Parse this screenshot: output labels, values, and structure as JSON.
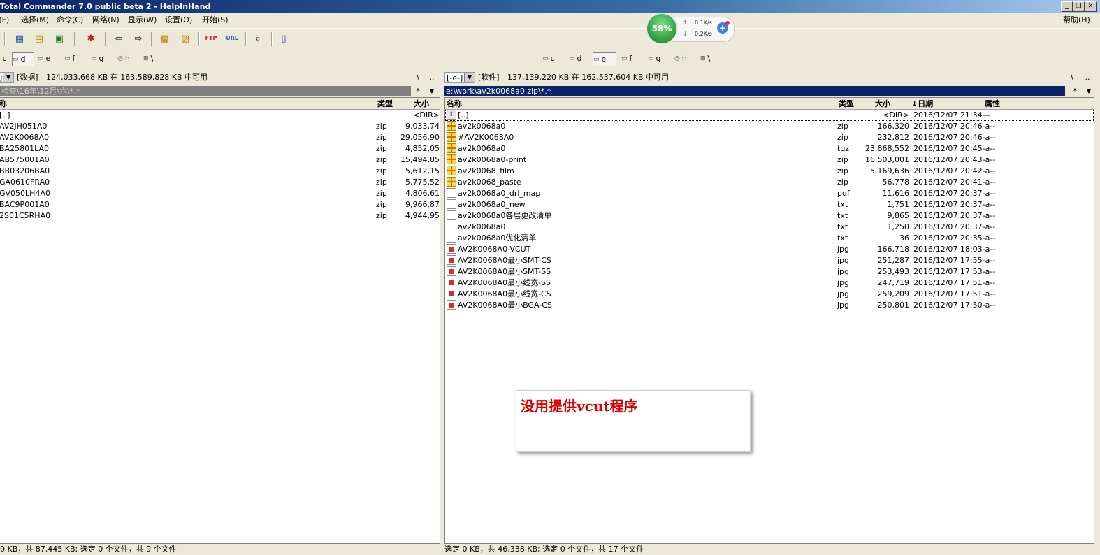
{
  "window": {
    "title": "Total Commander 7.0 public beta 2 - HelpInHand",
    "buttons": [
      "_",
      "❐",
      "✕"
    ]
  },
  "menu": {
    "items": [
      "F(F)",
      "选择(M)",
      "命令(C)",
      "网络(N)",
      "显示(W)",
      "设置(O)",
      "开始(S)"
    ],
    "help": "帮助(H)"
  },
  "netmon": {
    "percent": "58%",
    "upload": "0.1K/s",
    "download": "0.2K/s",
    "boost_icon": "+"
  },
  "left": {
    "drives": [
      {
        "letter": "c",
        "active": false
      },
      {
        "letter": "d",
        "active": true
      },
      {
        "letter": "e",
        "active": false
      },
      {
        "letter": "f",
        "active": false
      },
      {
        "letter": "g",
        "active": false
      },
      {
        "letter": "h",
        "active": false
      },
      {
        "letter": "\\",
        "active": false
      }
    ],
    "drive_combo": "]",
    "volume": "[数据]",
    "freespace": "124,033,668 KB 在 163,589,828 KB 中可用",
    "root_btn": "\\",
    "up_btn": "..",
    "path": "检查\\16年\\12月\\六\\*.*",
    "star_btn": "*",
    "columns": {
      "name": "称",
      "type": "类型",
      "size": "大小"
    },
    "files": [
      {
        "name": "[..]",
        "type": "",
        "size": "<DIR>"
      },
      {
        "name": "AV2JH051A0",
        "type": "zip",
        "size": "9,033,74"
      },
      {
        "name": "AV2K0068A0",
        "type": "zip",
        "size": "29,056,90"
      },
      {
        "name": "BA25801LA0",
        "type": "zip",
        "size": "4,852,05"
      },
      {
        "name": "AB575001A0",
        "type": "zip",
        "size": "15,494,85"
      },
      {
        "name": "BB03206BA0",
        "type": "zip",
        "size": "5,612,15"
      },
      {
        "name": "GA0610FRA0",
        "type": "zip",
        "size": "5,775,52"
      },
      {
        "name": "GV050LH4A0",
        "type": "zip",
        "size": "4,806,61"
      },
      {
        "name": "BAC9P001A0",
        "type": "zip",
        "size": "9,966,87"
      },
      {
        "name": "2S01C5RHA0",
        "type": "zip",
        "size": "4,944,95"
      }
    ],
    "status": "0 KB，共 87,445 KB; 选定 0 个文件，共 9 个文件"
  },
  "right": {
    "drives": [
      {
        "letter": "c",
        "active": false
      },
      {
        "letter": "d",
        "active": false
      },
      {
        "letter": "e",
        "active": true
      },
      {
        "letter": "f",
        "active": false
      },
      {
        "letter": "g",
        "active": false
      },
      {
        "letter": "h",
        "active": false
      },
      {
        "letter": "\\",
        "active": false
      }
    ],
    "drive_combo": "[-e-]",
    "volume": "[软件]",
    "freespace": "137,139,220 KB 在 162,537,604 KB 中可用",
    "root_btn": "\\",
    "up_btn": "..",
    "path": "e:\\work\\av2k0068a0.zip\\*.*",
    "star_btn": "*",
    "columns": {
      "name": "名称",
      "type": "类型",
      "size": "大小",
      "date": "↓日期",
      "attr": "属性"
    },
    "files": [
      {
        "icon": "up",
        "name": "[..]",
        "type": "",
        "size": "<DIR>",
        "date": "2016/12/07 21:34—"
      },
      {
        "icon": "zip",
        "name": "av2k0068a0",
        "type": "zip",
        "size": "166,320",
        "date": "2016/12/07 20:46-a--"
      },
      {
        "icon": "zip",
        "name": "#AV2K0068A0",
        "type": "zip",
        "size": "232,812",
        "date": "2016/12/07 20:46-a--"
      },
      {
        "icon": "zip",
        "name": "av2k0068a0",
        "type": "tgz",
        "size": "23,868,552",
        "date": "2016/12/07 20:45-a--"
      },
      {
        "icon": "zip",
        "name": "av2k0068a0-print",
        "type": "zip",
        "size": "16,503,001",
        "date": "2016/12/07 20:43-a--"
      },
      {
        "icon": "zip",
        "name": "av2k0068_film",
        "type": "zip",
        "size": "5,169,636",
        "date": "2016/12/07 20:42-a--"
      },
      {
        "icon": "zip",
        "name": "av2k0068_paste",
        "type": "zip",
        "size": "56,778",
        "date": "2016/12/07 20:41-a--"
      },
      {
        "icon": "doc",
        "name": "av2k0068a0_drl_map",
        "type": "pdf",
        "size": "11,616",
        "date": "2016/12/07 20:37-a--"
      },
      {
        "icon": "doc",
        "name": "av2k0068a0_new",
        "type": "txt",
        "size": "1,751",
        "date": "2016/12/07 20:37-a--"
      },
      {
        "icon": "doc",
        "name": "av2k0068a0各层更改清单",
        "type": "txt",
        "size": "9,865",
        "date": "2016/12/07 20:37-a--"
      },
      {
        "icon": "doc",
        "name": "av2k0068a0",
        "type": "txt",
        "size": "1,250",
        "date": "2016/12/07 20:37-a--"
      },
      {
        "icon": "doc",
        "name": "av2k0068a0优化清单",
        "type": "txt",
        "size": "36",
        "date": "2016/12/07 20:35-a--"
      },
      {
        "icon": "jpg",
        "name": "AV2K0068A0-VCUT",
        "type": "jpg",
        "size": "166,718",
        "date": "2016/12/07 18:03-a--"
      },
      {
        "icon": "jpg",
        "name": "AV2K0068A0最小SMT-CS",
        "type": "jpg",
        "size": "251,287",
        "date": "2016/12/07 17:55-a--"
      },
      {
        "icon": "jpg",
        "name": "AV2K0068A0最小SMT-SS",
        "type": "jpg",
        "size": "253,493",
        "date": "2016/12/07 17:53-a--"
      },
      {
        "icon": "jpg",
        "name": "AV2K0068A0最小线宽-SS",
        "type": "jpg",
        "size": "247,719",
        "date": "2016/12/07 17:51-a--"
      },
      {
        "icon": "jpg",
        "name": "AV2K0068A0最小线宽-CS",
        "type": "jpg",
        "size": "259,209",
        "date": "2016/12/07 17:51-a--"
      },
      {
        "icon": "jpg",
        "name": "AV2K0068A0最小BGA-CS",
        "type": "jpg",
        "size": "250,801",
        "date": "2016/12/07 17:50-a--"
      }
    ],
    "status": "选定 0 KB，共 46,338 KB; 选定 0 个文件，共 17 个文件"
  },
  "note": {
    "text": "没用提供vcut程序",
    "color": "#e00000"
  },
  "colors": {
    "active_path": "#0a246a",
    "inactive_path": "#808080",
    "title_start": "#0a246a",
    "title_end": "#a6caf0"
  }
}
